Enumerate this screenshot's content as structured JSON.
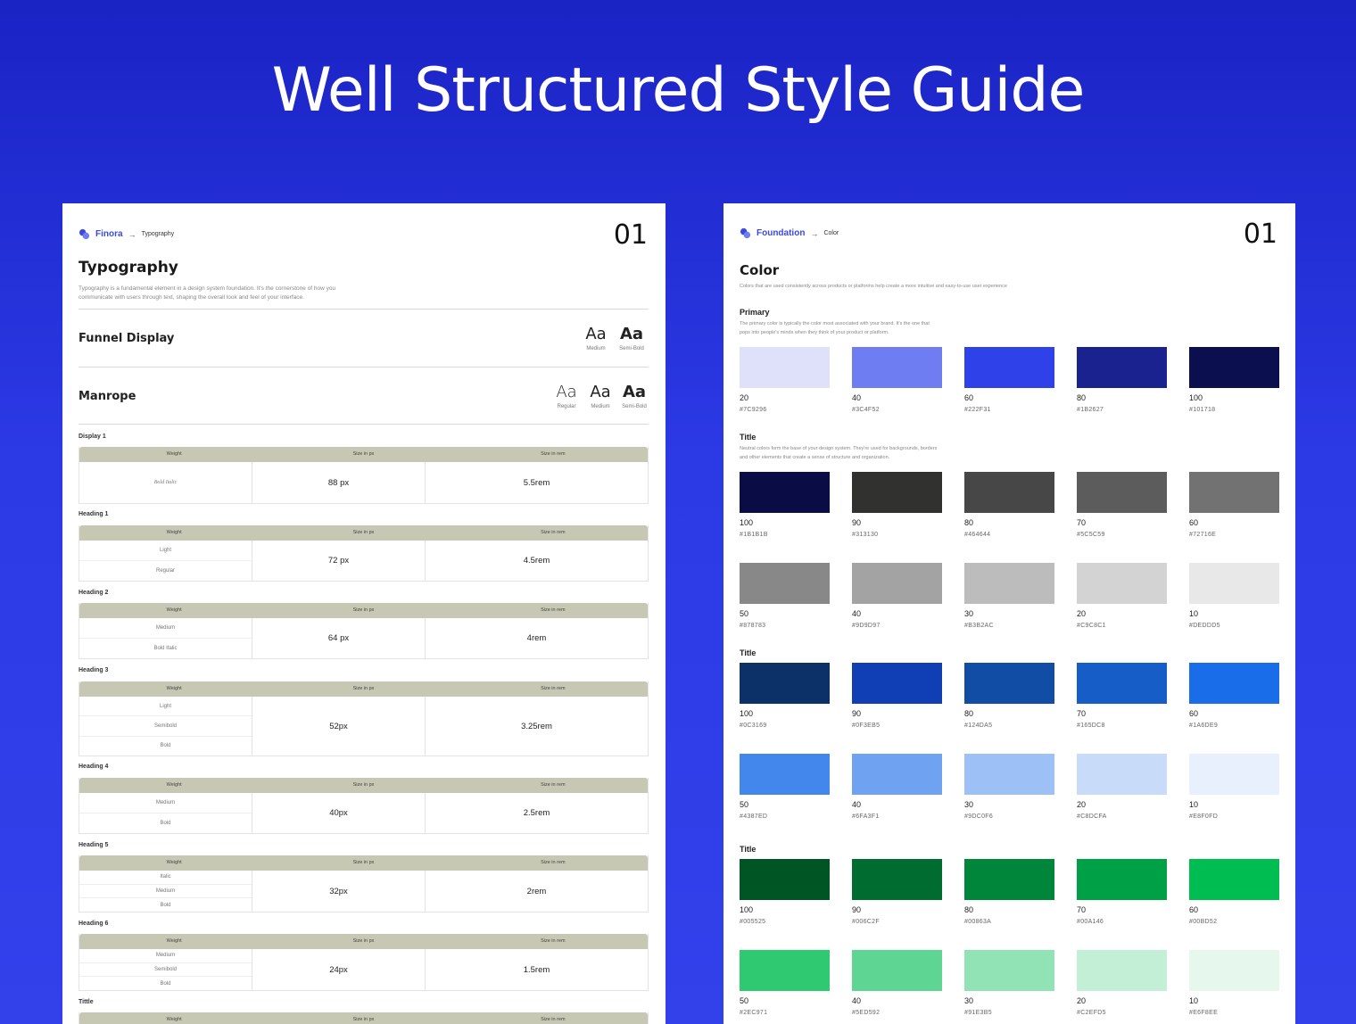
{
  "hero": {
    "title": "Well Structured Style Guide"
  },
  "typography_page": {
    "breadcrumb": {
      "brand": "Finora",
      "current": "Typography"
    },
    "page_number": "01",
    "title": "Typography",
    "description_line1": "Typography is a fundamental element in a design system foundation. It's the cornerstone of how you",
    "description_line2": "communicate with users through text, shaping the overall look and feel of your interface.",
    "fonts": [
      {
        "name": "Funnel Display",
        "samples": [
          {
            "aa": "Aa",
            "weight": "Medium"
          },
          {
            "aa": "Aa",
            "weight": "Semi-Bold"
          }
        ]
      },
      {
        "name": "Manrope",
        "samples": [
          {
            "aa": "Aa",
            "weight": "Regular"
          },
          {
            "aa": "Aa",
            "weight": "Medium"
          },
          {
            "aa": "Aa",
            "weight": "Semi-Bold"
          }
        ]
      }
    ],
    "table_headers": {
      "weight": "Weight",
      "px": "Size in px",
      "rem": "Size in rem"
    },
    "styles": [
      {
        "label": "Display 1",
        "weights": [
          "Bold Italic"
        ],
        "px": "88 px",
        "rem": "5.5rem"
      },
      {
        "label": "Heading 1",
        "weights": [
          "Light",
          "Regular"
        ],
        "px": "72 px",
        "rem": "4.5rem"
      },
      {
        "label": "Heading 2",
        "weights": [
          "Medium",
          "Bold Italic"
        ],
        "px": "64 px",
        "rem": "4rem"
      },
      {
        "label": "Heading 3",
        "weights": [
          "Light",
          "Semibold",
          "Bold"
        ],
        "px": "52px",
        "rem": "3.25rem"
      },
      {
        "label": "Heading 4",
        "weights": [
          "Medium",
          "Bold"
        ],
        "px": "40px",
        "rem": "2.5rem"
      },
      {
        "label": "Heading 5",
        "weights": [
          "Italic",
          "Medium",
          "Bold"
        ],
        "px": "32px",
        "rem": "2rem"
      },
      {
        "label": "Heading 6",
        "weights": [
          "Medium",
          "Semibold",
          "Bold"
        ],
        "px": "24px",
        "rem": "1.5rem"
      },
      {
        "label": "Tittle",
        "weights": [],
        "px": "",
        "rem": ""
      }
    ]
  },
  "color_page": {
    "breadcrumb": {
      "brand": "Foundation",
      "current": "Color"
    },
    "page_number": "01",
    "title": "Color",
    "description": "Colors that are used consistently across products or platforms help create a more intuitive and easy-to-use user experience",
    "groups": [
      {
        "title": "Primary",
        "desc_line1": "The primary color is typically the color most associated with your brand. It's the one that",
        "desc_line2": "pops into people's minds when they think of your product or platform.",
        "rows": [
          [
            {
              "num": "20",
              "hex": "#7C9296",
              "color": "#dfe1fb"
            },
            {
              "num": "40",
              "hex": "#3C4F52",
              "color": "#6e7ef2"
            },
            {
              "num": "60",
              "hex": "#222F31",
              "color": "#2f42e9"
            },
            {
              "num": "80",
              "hex": "#1B2627",
              "color": "#1a2290"
            },
            {
              "num": "100",
              "hex": "#101718",
              "color": "#0b0f4f"
            }
          ]
        ]
      },
      {
        "title": "Title",
        "desc_line1": "Neutral colors form the base of your design system. They're used for backgrounds, borders",
        "desc_line2": "and other elements that create a sense of structure and organization.",
        "rows": [
          [
            {
              "num": "100",
              "hex": "#1B1B1B",
              "color": "#0a0d45"
            },
            {
              "num": "90",
              "hex": "#313130",
              "color": "#313130"
            },
            {
              "num": "80",
              "hex": "#464644",
              "color": "#474747"
            },
            {
              "num": "70",
              "hex": "#5C5C59",
              "color": "#5c5c5c"
            },
            {
              "num": "60",
              "hex": "#72716E",
              "color": "#727272"
            }
          ],
          [
            {
              "num": "50",
              "hex": "#878783",
              "color": "#888888"
            },
            {
              "num": "40",
              "hex": "#9D9D97",
              "color": "#a3a3a3"
            },
            {
              "num": "30",
              "hex": "#B3B2AC",
              "color": "#bcbcbc"
            },
            {
              "num": "20",
              "hex": "#C9C8C1",
              "color": "#d3d3d3"
            },
            {
              "num": "10",
              "hex": "#DEDDD5",
              "color": "#e8e8e8"
            }
          ]
        ]
      },
      {
        "title": "Title",
        "desc_line1": "",
        "desc_line2": "",
        "rows": [
          [
            {
              "num": "100",
              "hex": "#0C3169",
              "color": "#0c3169"
            },
            {
              "num": "90",
              "hex": "#0F3EB5",
              "color": "#0f3eb5"
            },
            {
              "num": "80",
              "hex": "#124DA5",
              "color": "#124da5"
            },
            {
              "num": "70",
              "hex": "#165DC8",
              "color": "#165dc8"
            },
            {
              "num": "60",
              "hex": "#1A6DE9",
              "color": "#1a6de9"
            }
          ],
          [
            {
              "num": "50",
              "hex": "#4387ED",
              "color": "#4387ed"
            },
            {
              "num": "40",
              "hex": "#6FA3F1",
              "color": "#6fa3f1"
            },
            {
              "num": "30",
              "hex": "#9DC0F6",
              "color": "#9dc0f6"
            },
            {
              "num": "20",
              "hex": "#C8DCFA",
              "color": "#c8dcfa"
            },
            {
              "num": "10",
              "hex": "#E8F0FD",
              "color": "#e8f0fd"
            }
          ]
        ]
      },
      {
        "title": "Title",
        "desc_line1": "",
        "desc_line2": "",
        "rows": [
          [
            {
              "num": "100",
              "hex": "#005525",
              "color": "#005525"
            },
            {
              "num": "90",
              "hex": "#006C2F",
              "color": "#006c2f"
            },
            {
              "num": "80",
              "hex": "#00863A",
              "color": "#00863a"
            },
            {
              "num": "70",
              "hex": "#00A146",
              "color": "#00a146"
            },
            {
              "num": "60",
              "hex": "#00BD52",
              "color": "#00bd52"
            }
          ],
          [
            {
              "num": "50",
              "hex": "#2EC971",
              "color": "#2ec971"
            },
            {
              "num": "40",
              "hex": "#5ED592",
              "color": "#5ed592"
            },
            {
              "num": "30",
              "hex": "#91E3B5",
              "color": "#91e3b5"
            },
            {
              "num": "20",
              "hex": "#C2EFD5",
              "color": "#c2efd5"
            },
            {
              "num": "10",
              "hex": "#E6F8EE",
              "color": "#e6f8ee"
            }
          ]
        ]
      }
    ]
  }
}
